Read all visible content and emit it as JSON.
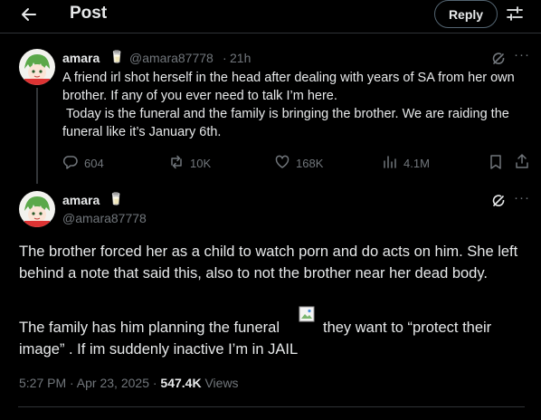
{
  "header": {
    "title": "Post",
    "reply_label": "Reply"
  },
  "tweet1": {
    "name": "amara",
    "badge": "🥛",
    "handle": "@amara87778",
    "separator": "·",
    "time": "21h",
    "text": "A friend irl shot herself in the head after dealing with years of SA from her own brother. If any of you ever need to talk I’m here.\n Today is the funeral and the family is bringing the brother. We are raiding the funeral like it’s January 6th.",
    "actions": {
      "replies": "604",
      "reposts": "10K",
      "likes": "168K",
      "views": "4.1M"
    }
  },
  "tweet2": {
    "name": "amara",
    "badge": "🥛",
    "handle": "@amara87778",
    "paragraph1": "The brother forced her as a child to watch porn and do acts on him. She left behind a note that said this, also to not the brother near her dead body.",
    "paragraph2_start": "The family has him planning the funeral",
    "paragraph2_end": "they want to “protect their",
    "paragraph2_line2": "image” . If im suddenly inactive I’m in JAIL",
    "meta_time": "5:27 PM · Apr 23, 2025 · ",
    "views_count": "547.4K",
    "views_label": " Views"
  },
  "colors": {
    "background": "#000000",
    "text": "#e7e9ea",
    "secondary": "#71767b",
    "divider": "#2f3336"
  }
}
